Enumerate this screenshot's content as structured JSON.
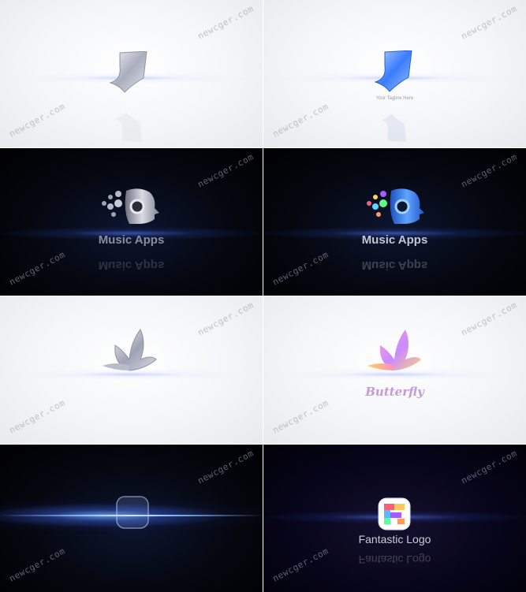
{
  "watermark": "newcger.com",
  "panels": [
    {
      "theme": "light",
      "logo_icon": "bird-logo-icon",
      "caption": ""
    },
    {
      "theme": "light",
      "logo_icon": "bird-logo-icon",
      "caption": "Your Tagline Here"
    },
    {
      "theme": "dark",
      "logo_icon": "music-head-icon",
      "caption": "Music Apps"
    },
    {
      "theme": "dark",
      "logo_icon": "music-head-icon",
      "caption": "Music Apps"
    },
    {
      "theme": "light",
      "logo_icon": "butterfly-icon",
      "caption": ""
    },
    {
      "theme": "light",
      "logo_icon": "butterfly-icon",
      "caption": "Butterfly"
    },
    {
      "theme": "dark",
      "logo_icon": "square-f-icon",
      "caption": ""
    },
    {
      "theme": "dark",
      "logo_icon": "square-f-icon",
      "caption": "Fantastic Logo"
    }
  ],
  "colors": {
    "light_bg": "#f4f5f8",
    "dark_bg": "#05070f",
    "accent_blue": "#3a7cff",
    "butterfly_pink": "#c59ad6"
  }
}
